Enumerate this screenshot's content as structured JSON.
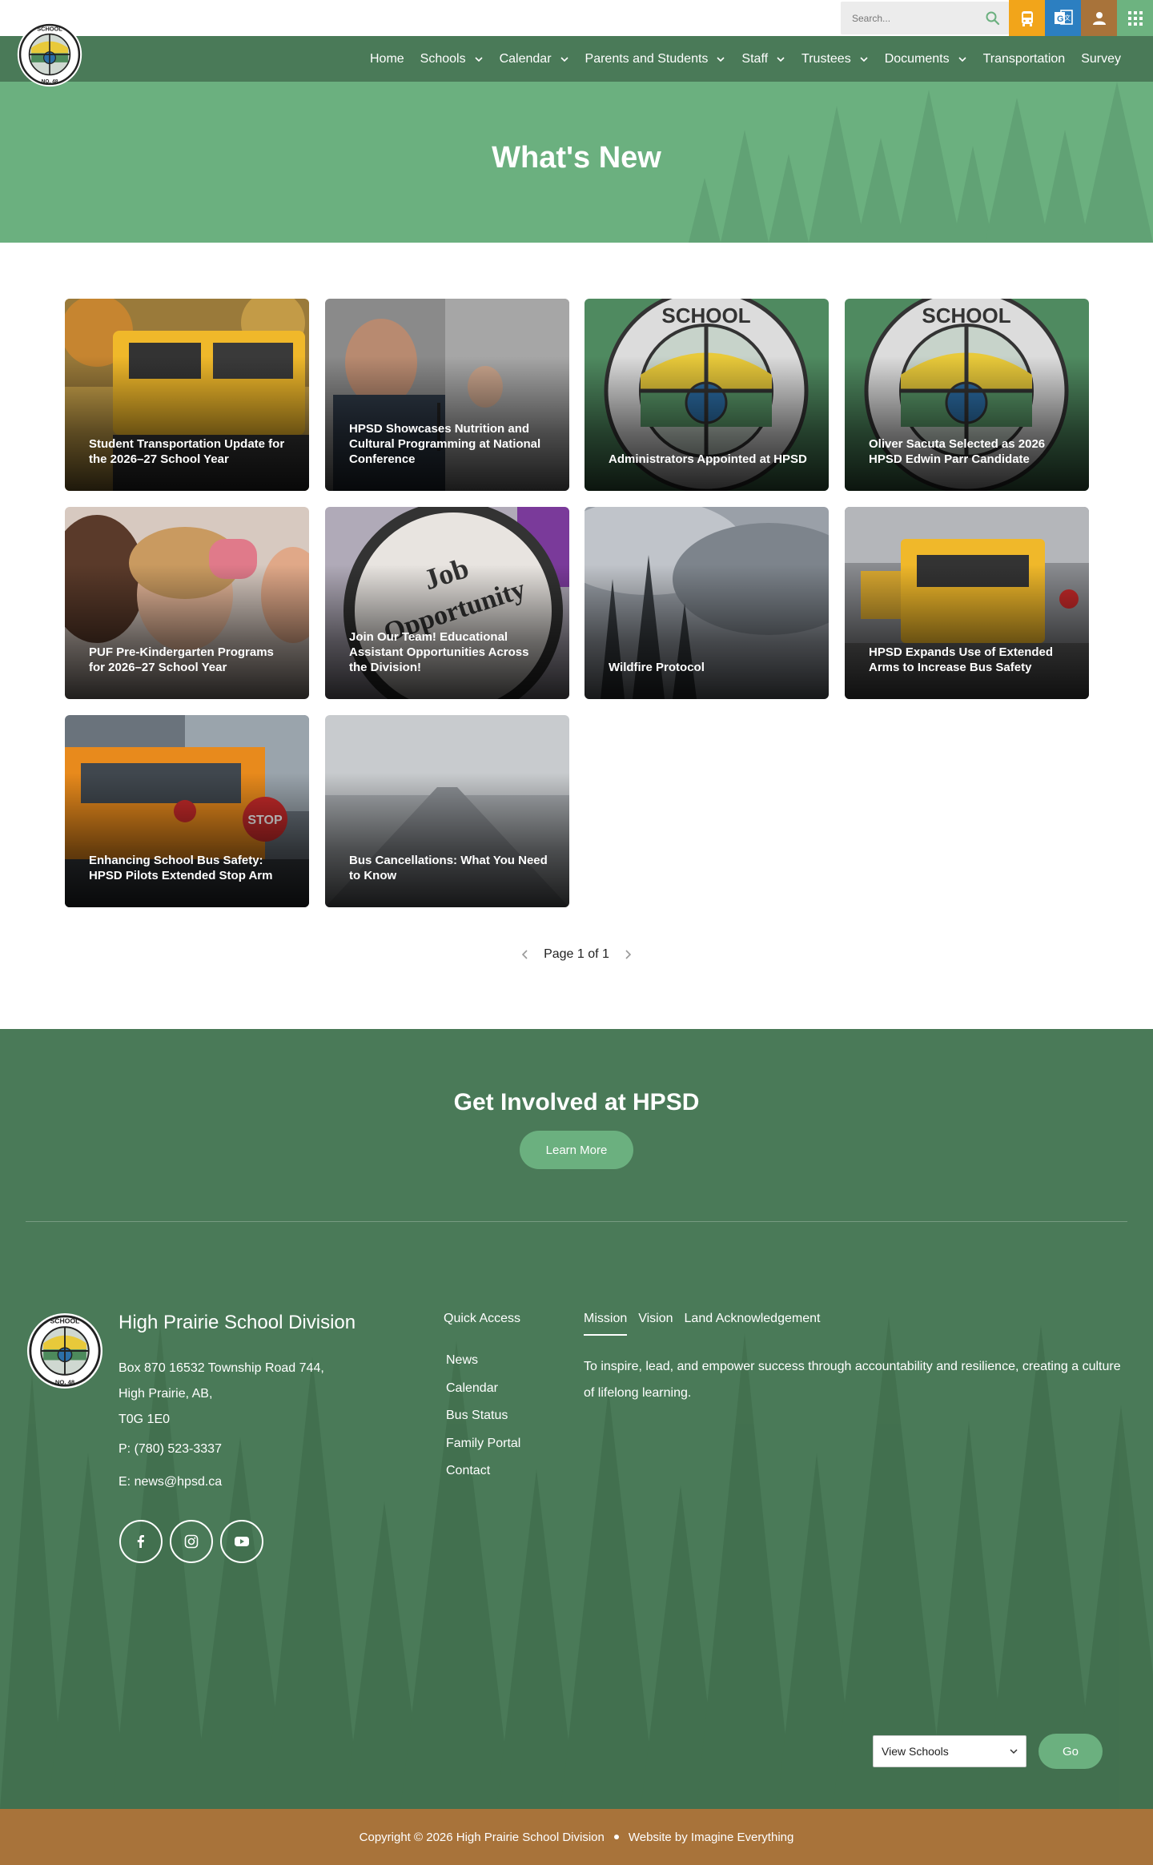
{
  "colors": {
    "dark_green": "#4a7a58",
    "light_green": "#6bb07f",
    "bus_yellow": "#f2a51a",
    "translate_blue": "#2c7fc1",
    "brown": "#a8733a"
  },
  "topbar": {
    "search_placeholder": "Search...",
    "icons": [
      "search-icon",
      "bus-icon",
      "translate-icon",
      "user-icon",
      "apps-grid-icon"
    ]
  },
  "nav": {
    "items": [
      {
        "label": "Home",
        "dropdown": false
      },
      {
        "label": "Schools",
        "dropdown": true
      },
      {
        "label": "Calendar",
        "dropdown": true
      },
      {
        "label": "Parents and Students",
        "dropdown": true
      },
      {
        "label": "Staff",
        "dropdown": true
      },
      {
        "label": "Trustees",
        "dropdown": true
      },
      {
        "label": "Documents",
        "dropdown": true
      },
      {
        "label": "Transportation",
        "dropdown": false
      },
      {
        "label": "Survey",
        "dropdown": false
      }
    ]
  },
  "hero": {
    "title": "What's New"
  },
  "news": [
    {
      "title": "Student Transportation Update for the 2026–27 School Year",
      "image": "school-bus-photo"
    },
    {
      "title": "HPSD Showcases Nutrition and Cultural Programming at National Conference",
      "image": "speaker-photo"
    },
    {
      "title": "Administrators Appointed at HPSD",
      "image": "division-logo"
    },
    {
      "title": "Oliver Sacuta Selected as 2026 HPSD Edwin Parr Candidate",
      "image": "division-logo"
    },
    {
      "title": "PUF Pre-Kindergarten Programs for 2026–27 School Year",
      "image": "children-photo"
    },
    {
      "title": "Join Our Team! Educational Assistant Opportunities Across the Division!",
      "image": "job-opportunity-photo"
    },
    {
      "title": "Wildfire Protocol",
      "image": "wildfire-smoke-photo"
    },
    {
      "title": "HPSD Expands Use of Extended Arms to Increase Bus Safety",
      "image": "bus-fleet-photo"
    },
    {
      "title": "Enhancing School Bus Safety: HPSD Pilots Extended Stop Arm",
      "image": "bus-stop-arm-photo"
    },
    {
      "title": "Bus Cancellations: What You Need to Know",
      "image": "foggy-road-photo"
    }
  ],
  "pagination": {
    "label": "Page 1 of 1"
  },
  "involved": {
    "title": "Get Involved at HPSD",
    "button": "Learn More"
  },
  "footer": {
    "org_name": "High Prairie School Division",
    "address_line1": "Box 870 16532 Township Road 744,",
    "address_line2": "High Prairie, AB,",
    "address_line3": "T0G 1E0",
    "phone": "P: (780) 523-3337",
    "email": "E: news@hpsd.ca",
    "social": [
      "facebook-icon",
      "instagram-icon",
      "youtube-icon"
    ],
    "quick_access_title": "Quick Access",
    "quick_access": [
      "News",
      "Calendar",
      "Bus Status",
      "Family Portal",
      "Contact"
    ],
    "tabs": [
      "Mission",
      "Vision",
      "Land Acknowledgement"
    ],
    "active_tab": "Mission",
    "mission_text": "To inspire, lead, and empower success through accountability and resilience, creating a culture of lifelong learning.",
    "schools_select": "View Schools",
    "go_button": "Go"
  },
  "copyright": {
    "text": "Copyright © 2026 High Prairie School Division",
    "credit": "Website by Imagine Everything"
  }
}
